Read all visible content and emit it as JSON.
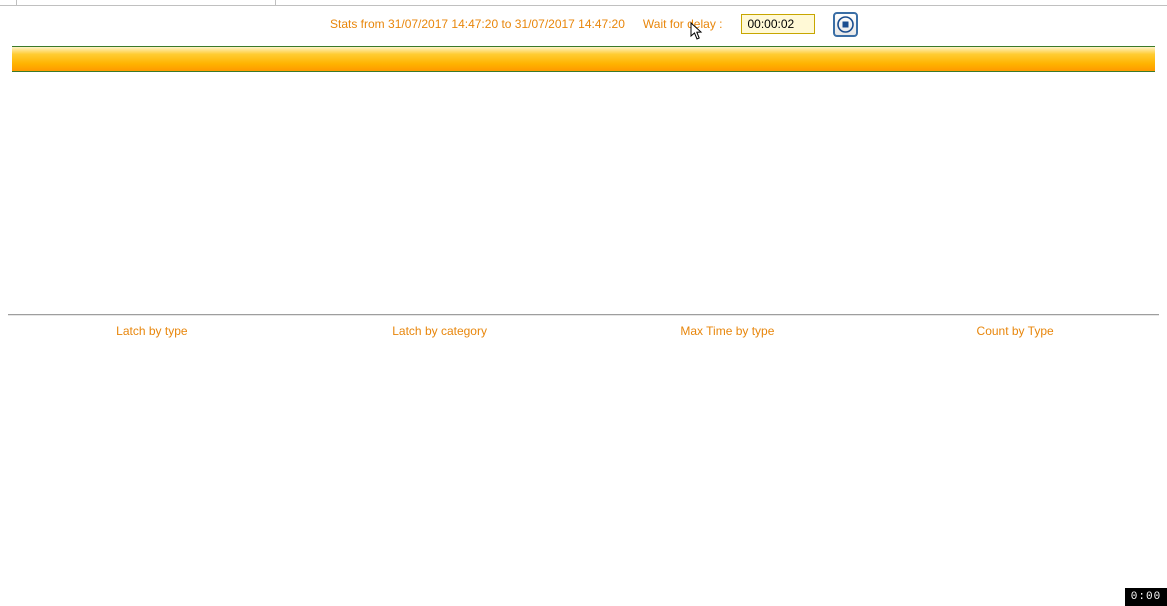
{
  "header": {
    "stats_text": "Stats from 31/07/2017 14:47:20 to 31/07/2017 14:47:20",
    "wait_label": "Wait for delay :",
    "delay_value": "00:00:02"
  },
  "columns": {
    "c1": "Latch by type",
    "c2": "Latch by category",
    "c3": "Max Time by type",
    "c4": "Count by Type"
  },
  "footer": {
    "timer": "0:00"
  }
}
